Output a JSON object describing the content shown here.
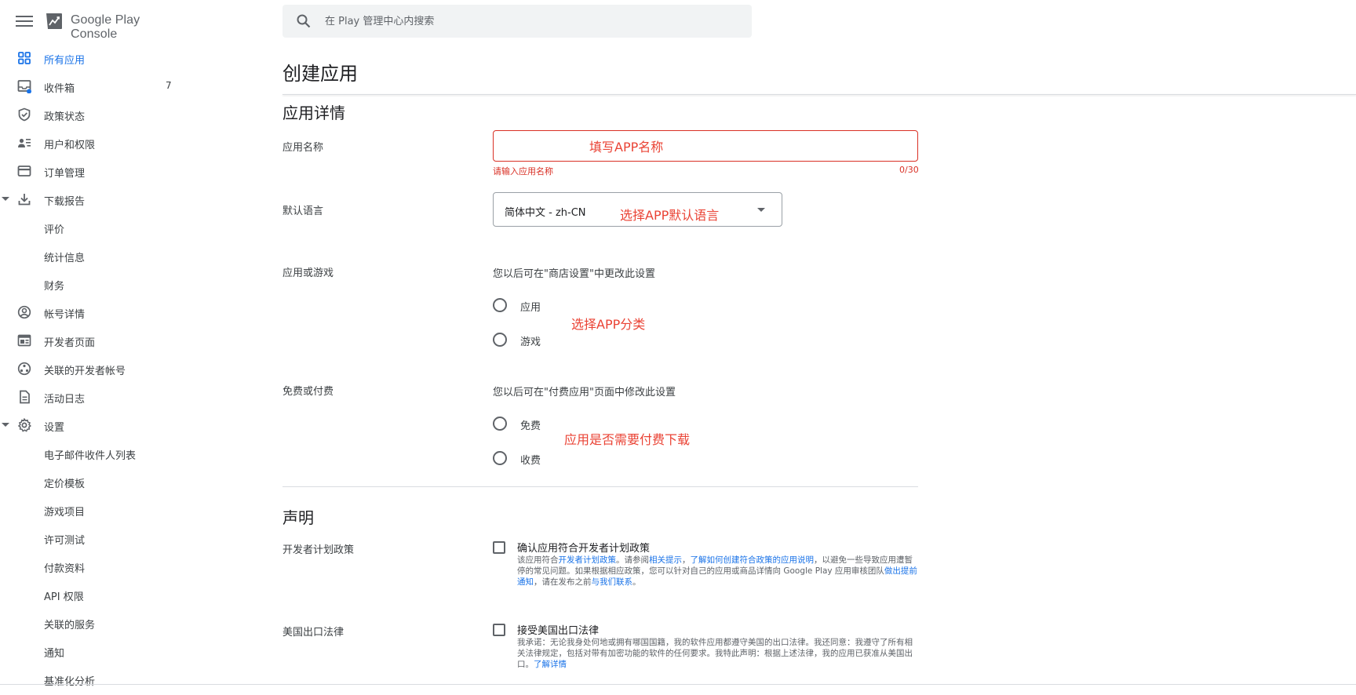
{
  "app": {
    "logo_text": "Google Play Console"
  },
  "search": {
    "placeholder": "在 Play 管理中心内搜索"
  },
  "sidebar": {
    "items": [
      {
        "label": "所有应用",
        "icon": "grid-icon",
        "active": true
      },
      {
        "label": "收件箱",
        "icon": "inbox-icon",
        "badge": "7"
      },
      {
        "label": "政策状态",
        "icon": "shield-check-icon"
      },
      {
        "label": "用户和权限",
        "icon": "people-list-icon"
      },
      {
        "label": "订单管理",
        "icon": "credit-card-icon"
      },
      {
        "label": "下载报告",
        "icon": "download-icon",
        "expanded": true
      },
      {
        "label": "评价",
        "sub": true
      },
      {
        "label": "统计信息",
        "sub": true
      },
      {
        "label": "财务",
        "sub": true
      },
      {
        "label": "帐号详情",
        "icon": "account-circle-icon"
      },
      {
        "label": "开发者页面",
        "icon": "web-page-icon"
      },
      {
        "label": "关联的开发者帐号",
        "icon": "linked-accounts-icon"
      },
      {
        "label": "活动日志",
        "icon": "document-icon"
      },
      {
        "label": "设置",
        "icon": "gear-icon",
        "expanded": true
      },
      {
        "label": "电子邮件收件人列表",
        "sub": true
      },
      {
        "label": "定价模板",
        "sub": true
      },
      {
        "label": "游戏项目",
        "sub": true
      },
      {
        "label": "许可测试",
        "sub": true
      },
      {
        "label": "付款资料",
        "sub": true
      },
      {
        "label": "API 权限",
        "sub": true
      },
      {
        "label": "关联的服务",
        "sub": true
      },
      {
        "label": "通知",
        "sub": true
      },
      {
        "label": "基准化分析",
        "sub": true
      }
    ]
  },
  "main": {
    "title": "创建应用",
    "details": {
      "section_title": "应用详情",
      "name_label": "应用名称",
      "name_value": "",
      "name_error": "请输入应用名称",
      "name_counter": "0/30",
      "language_label": "默认语言",
      "language_value": "简体中文 - zh-CN",
      "type_label": "应用或游戏",
      "type_hint": "您以后可在\"商店设置\"中更改此设置",
      "type_options": [
        "应用",
        "游戏"
      ],
      "price_label": "免费或付费",
      "price_hint": "您以后可在\"付费应用\"页面中修改此设置",
      "price_options": [
        "免费",
        "收费"
      ]
    },
    "declarations": {
      "section_title": "声明",
      "policy_label": "开发者计划政策",
      "policy_check": "确认应用符合开发者计划政策",
      "policy_desc": {
        "t1": "该应用符合",
        "l1": "开发者计划政策",
        "t2": "。请参阅",
        "l2": "相关提示",
        "t3": "，",
        "l3": "了解如何创建符合政策的应用说明",
        "t4": "，以避免一些导致应用遭暂停的常见问题。如果根据相应政策，您可以针对自己的应用或商品详情向 Google Play 应用审核团队",
        "l4": "做出提前通知",
        "t5": "，请在发布之前",
        "l5": "与我们联系",
        "t6": "。"
      },
      "export_label": "美国出口法律",
      "export_check": "接受美国出口法律",
      "export_desc": {
        "t1": "我承诺：无论我身处何地或拥有哪国国籍，我的软件应用都遵守美国的出口法律。我还同意：我遵守了所有相关法律规定，包括对带有加密功能的软件的任何要求。我特此声明：根据上述法律，我的应用已获准从美国出口。",
        "l1": "了解详情"
      }
    }
  },
  "annotations": {
    "name": "填写APP名称",
    "language": "选择APP默认语言",
    "type": "选择APP分类",
    "price": "应用是否需要付费下载"
  },
  "colors": {
    "accent": "#1a73e8",
    "error": "#d93025",
    "annotation": "#ea4335"
  }
}
